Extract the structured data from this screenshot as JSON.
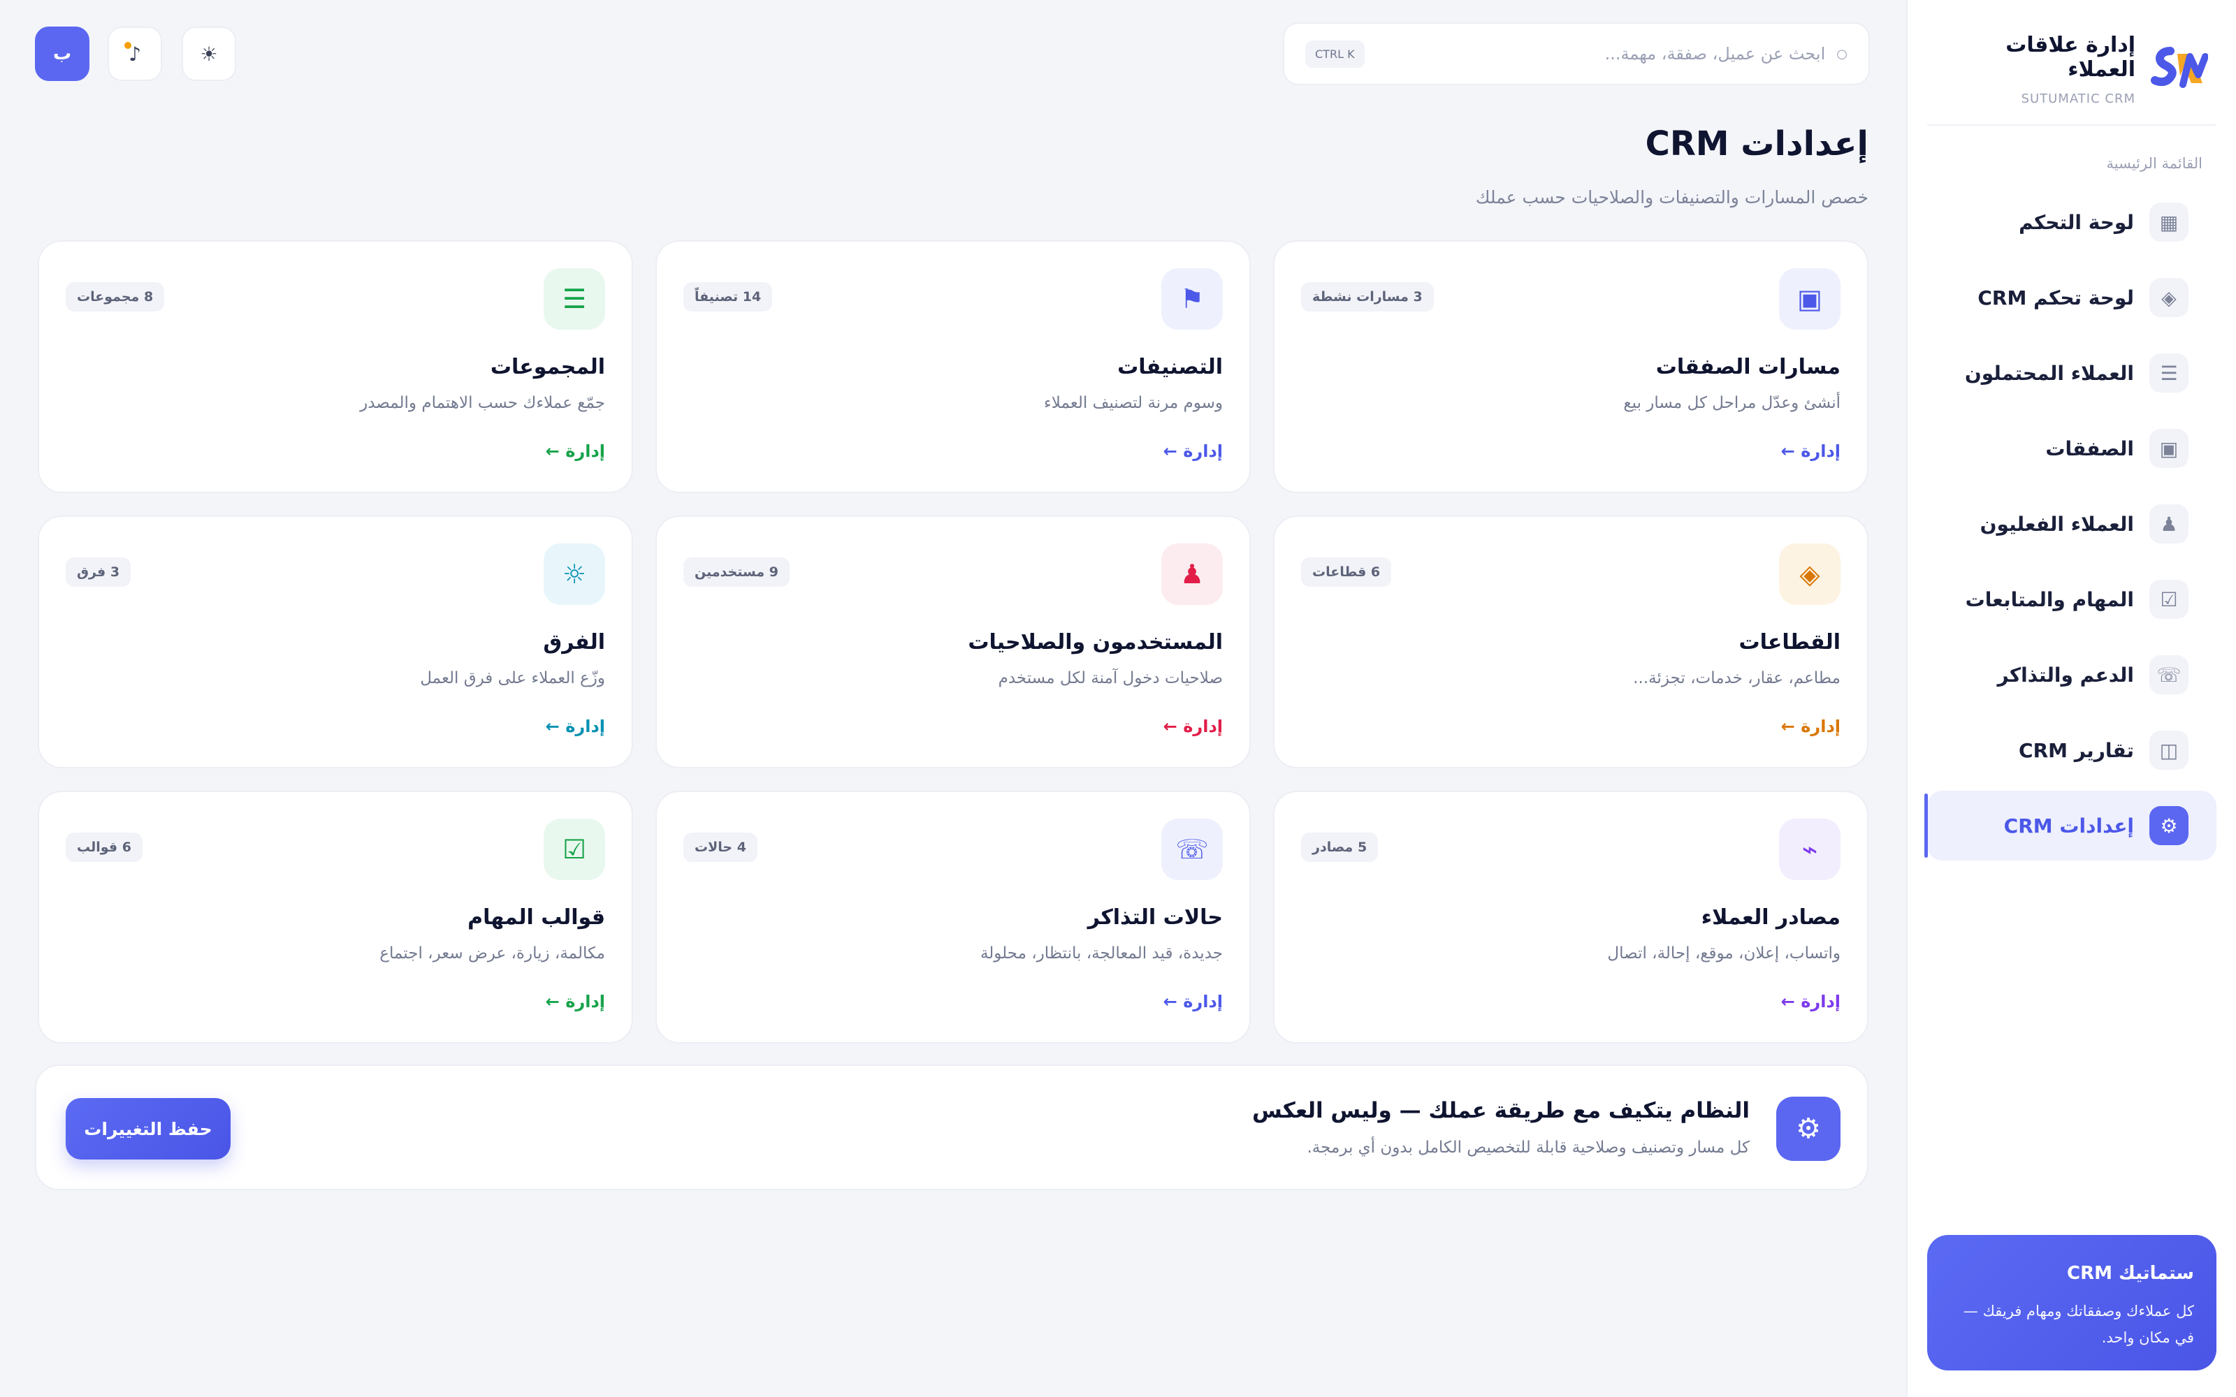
{
  "brand": {
    "title": "إدارة علاقات العملاء",
    "subtitle": "SUTUMATIC CRM",
    "logo_icon": "sm-logo-icon"
  },
  "sidebar": {
    "section_label": "القائمة الرئيسية",
    "items": [
      {
        "label": "لوحة التحكم",
        "icon": "▦",
        "icon_name": "grid-icon"
      },
      {
        "label": "لوحة تحكم CRM",
        "icon": "◈",
        "icon_name": "diamond-icon"
      },
      {
        "label": "العملاء المحتملون",
        "icon": "☰",
        "icon_name": "list-icon"
      },
      {
        "label": "الصفقات",
        "icon": "▣",
        "icon_name": "box-icon"
      },
      {
        "label": "العملاء الفعليون",
        "icon": "♟",
        "icon_name": "user-icon"
      },
      {
        "label": "المهام والمتابعات",
        "icon": "☑",
        "icon_name": "checkbox-icon"
      },
      {
        "label": "الدعم والتذاكر",
        "icon": "☏",
        "icon_name": "phone-icon"
      },
      {
        "label": "تقارير CRM",
        "icon": "◫",
        "icon_name": "report-icon"
      },
      {
        "label": "إعدادات CRM",
        "icon": "⚙",
        "icon_name": "gear-icon",
        "active": true
      }
    ],
    "promo": {
      "title": "ستماتيك CRM",
      "text": "كل عملاءك وصفقاتك ومهام فريقك — في مكان واحد."
    }
  },
  "topbar": {
    "search_placeholder": "ابحث عن عميل، صفقة، مهمة...",
    "search_value": "",
    "shortcut": "CTRL K",
    "theme_icon": "☀",
    "music_icon": "♪",
    "user_initial": "ب"
  },
  "page": {
    "title": "إعدادات CRM",
    "subtitle": "خصص المسارات والتصنيفات والصلاحيات حسب عملك"
  },
  "cards": [
    {
      "title": "مسارات الصفقات",
      "desc": "أنشئ وعدّل مراحل كل مسار بيع",
      "badge": "3 مسارات نشطة",
      "link": "إدارة ←",
      "icon": "▣",
      "icon_name": "pipeline-icon",
      "accent": "#4c58e8",
      "tint": "#eef0fd"
    },
    {
      "title": "التصنيفات",
      "desc": "وسوم مرنة لتصنيف العملاء",
      "badge": "14 تصنيفاً",
      "link": "إدارة ←",
      "icon": "⚑",
      "icon_name": "flag-icon",
      "accent": "#4c58e8",
      "tint": "#eef0fd"
    },
    {
      "title": "المجموعات",
      "desc": "جمّع عملاءك حسب الاهتمام والمصدر",
      "badge": "8 مجموعات",
      "link": "إدارة ←",
      "icon": "☰",
      "icon_name": "groups-icon",
      "accent": "#16a34a",
      "tint": "#e9f8ef"
    },
    {
      "title": "القطاعات",
      "desc": "مطاعم، عقار، خدمات، تجزئة...",
      "badge": "6 قطاعات",
      "link": "إدارة ←",
      "icon": "◈",
      "icon_name": "sectors-icon",
      "accent": "#d97706",
      "tint": "#fdf3e2"
    },
    {
      "title": "المستخدمون والصلاحيات",
      "desc": "صلاحيات دخول آمنة لكل مستخدم",
      "badge": "9 مستخدمين",
      "link": "إدارة ←",
      "icon": "♟",
      "icon_name": "users-icon",
      "accent": "#e11d48",
      "tint": "#fdecef"
    },
    {
      "title": "الفرق",
      "desc": "وزّع العملاء على فرق العمل",
      "badge": "3 فرق",
      "link": "إدارة ←",
      "icon": "☼",
      "icon_name": "teams-icon",
      "accent": "#0891b2",
      "tint": "#e8f6fb"
    },
    {
      "title": "مصادر العملاء",
      "desc": "واتساب، إعلان، موقع، إحالة، اتصال",
      "badge": "5 مصادر",
      "link": "إدارة ←",
      "icon": "⌁",
      "icon_name": "sources-icon",
      "accent": "#7c3aed",
      "tint": "#f3eefd"
    },
    {
      "title": "حالات التذاكر",
      "desc": "جديدة، قيد المعالجة، بانتظار، محلولة",
      "badge": "4 حالات",
      "link": "إدارة ←",
      "icon": "☏",
      "icon_name": "ticket-status-icon",
      "accent": "#4c58e8",
      "tint": "#eef0fd"
    },
    {
      "title": "قوالب المهام",
      "desc": "مكالمة، زيارة، عرض سعر، اجتماع",
      "badge": "6 قوالب",
      "link": "إدارة ←",
      "icon": "☑",
      "icon_name": "task-template-icon",
      "accent": "#16a34a",
      "tint": "#e9f8ef"
    }
  ],
  "banner": {
    "title": "النظام يتكيف مع طريقة عملك — وليس العكس",
    "subtitle": "كل مسار وتصنيف وصلاحية قابلة للتخصيص الكامل بدون أي برمجة.",
    "icon": "⚙",
    "save_label": "حفظ التغييرات"
  },
  "colors": {
    "primary": "#5b67f0",
    "background": "#f4f5f9",
    "card": "#ffffff"
  }
}
